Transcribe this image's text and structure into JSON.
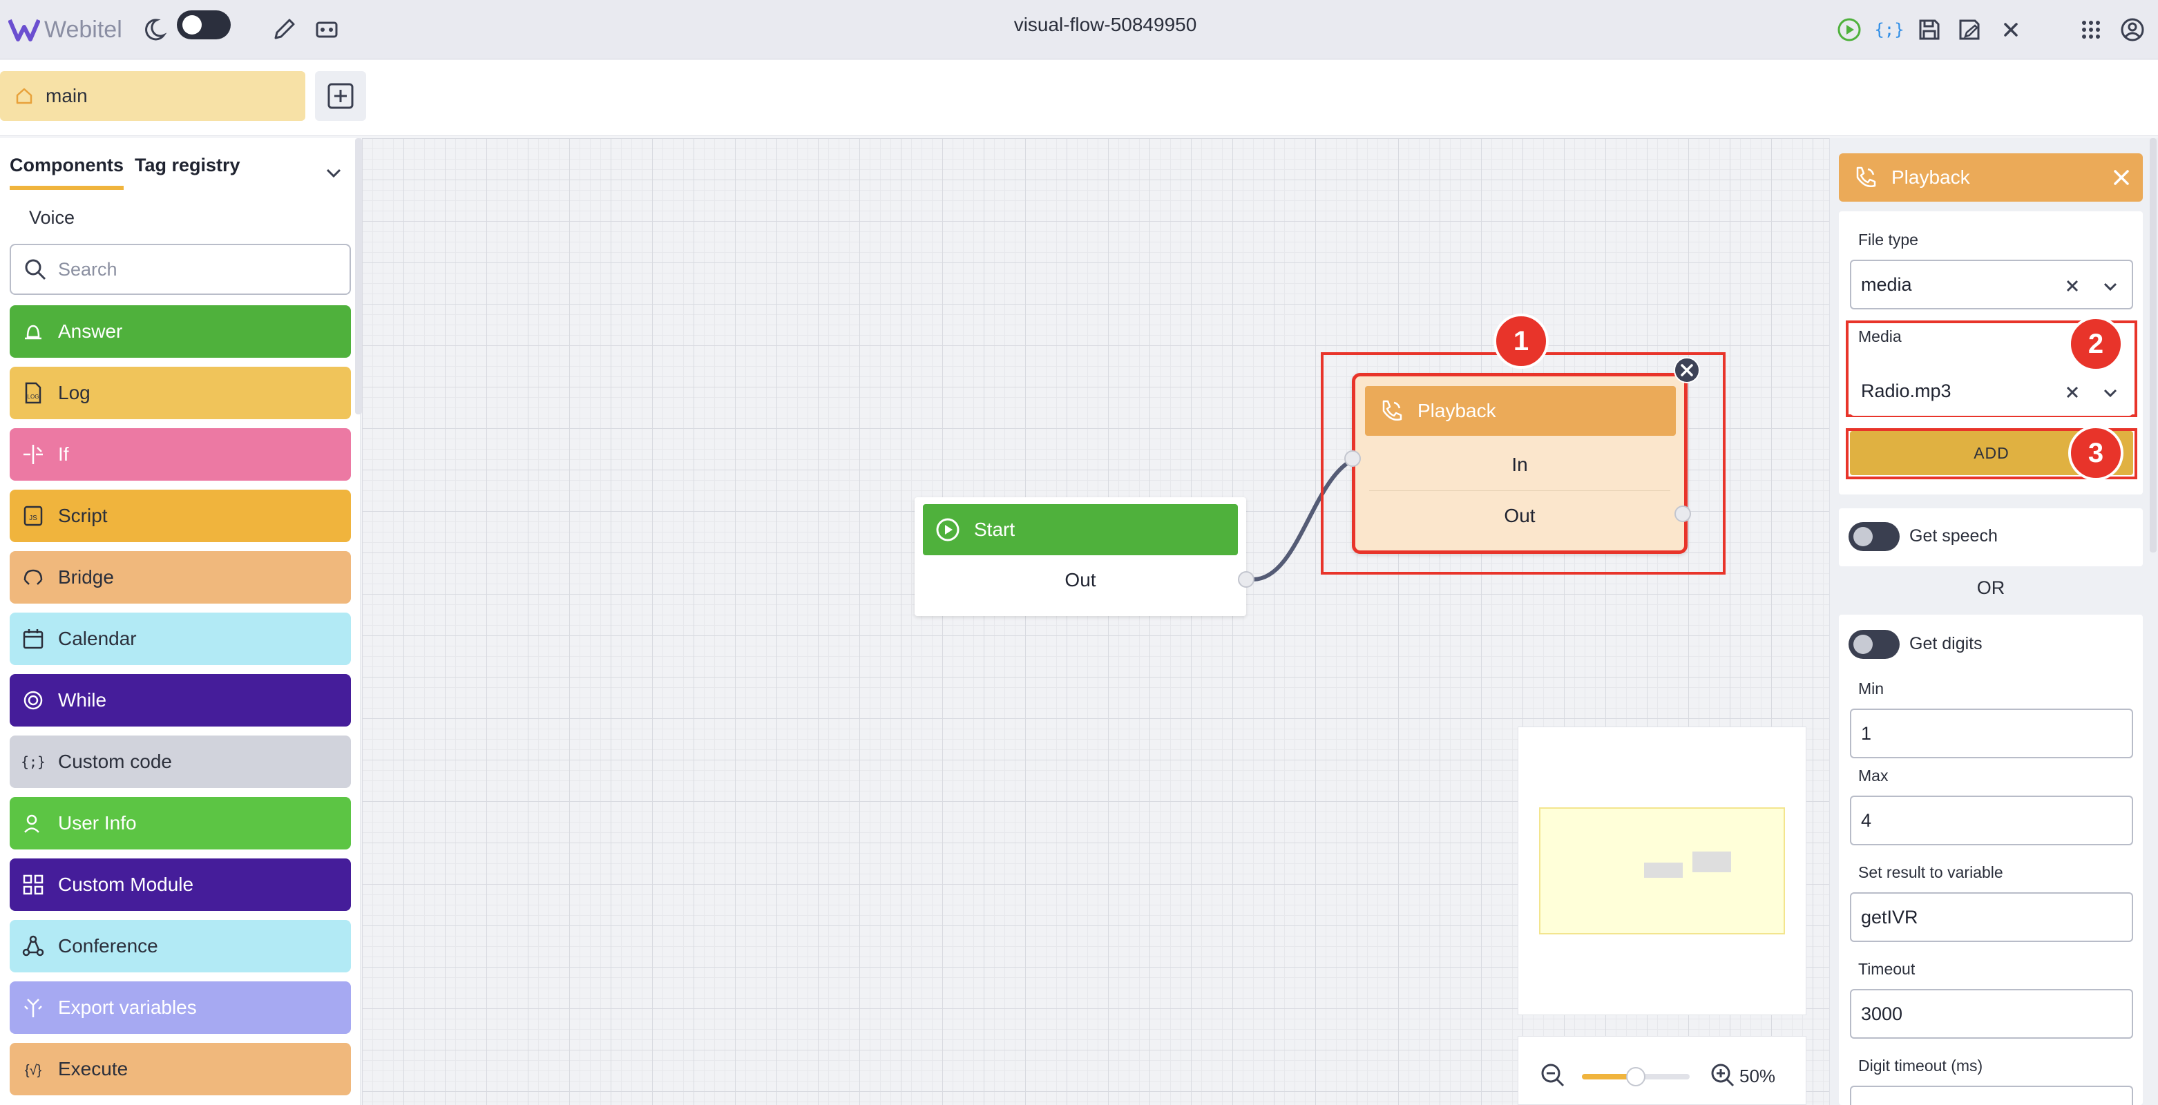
{
  "app": {
    "logo_text": "Webitel",
    "flow_title": "visual-flow-50849950",
    "colors": {
      "accent": "#f0b43d",
      "highlight": "#e8342a",
      "start_green": "#4fb13c",
      "playback_orange": "#ebaa58"
    }
  },
  "tabs": {
    "main_label": "main"
  },
  "sidebar": {
    "tab_components": "Components",
    "tab_tag_registry": "Tag registry",
    "section": "Voice",
    "search_placeholder": "Search",
    "items": [
      {
        "label": "Answer",
        "icon": "answer-icon",
        "bg": "#4fb13c",
        "fg": "#ffffff"
      },
      {
        "label": "Log",
        "icon": "log-icon",
        "bg": "#f0c45a",
        "fg": "#2b2f3b"
      },
      {
        "label": "If",
        "icon": "if-icon",
        "bg": "#ec79a3",
        "fg": "#ffffff"
      },
      {
        "label": "Script",
        "icon": "script-icon",
        "bg": "#f0b43d",
        "fg": "#2b2f3b"
      },
      {
        "label": "Bridge",
        "icon": "bridge-icon",
        "bg": "#f0b87c",
        "fg": "#2b2f3b"
      },
      {
        "label": "Calendar",
        "icon": "calendar-icon",
        "bg": "#b2eaf5",
        "fg": "#2b2f3b"
      },
      {
        "label": "While",
        "icon": "while-icon",
        "bg": "#451d9a",
        "fg": "#ffffff"
      },
      {
        "label": "Custom code",
        "icon": "custom-code-icon",
        "bg": "#d1d3dc",
        "fg": "#2b2f3b"
      },
      {
        "label": "User Info",
        "icon": "user-info-icon",
        "bg": "#5cc544",
        "fg": "#ffffff"
      },
      {
        "label": "Custom Module",
        "icon": "custom-module-icon",
        "bg": "#451d9a",
        "fg": "#ffffff"
      },
      {
        "label": "Conference",
        "icon": "conference-icon",
        "bg": "#b2eaf5",
        "fg": "#2b2f3b"
      },
      {
        "label": "Export variables",
        "icon": "export-variables-icon",
        "bg": "#a6a9f2",
        "fg": "#ffffff"
      },
      {
        "label": "Execute",
        "icon": "execute-icon",
        "bg": "#f0b87c",
        "fg": "#2b2f3b"
      }
    ]
  },
  "canvas": {
    "start_node": {
      "title": "Start",
      "out_label": "Out"
    },
    "playback_node": {
      "title": "Playback",
      "in_label": "In",
      "out_label": "Out"
    },
    "badges": [
      "1",
      "2",
      "3"
    ],
    "zoom": {
      "label": "50%",
      "level": 0.5
    }
  },
  "panel": {
    "title": "Playback",
    "file_type_label": "File type",
    "file_type_value": "media",
    "media_label": "Media",
    "media_value": "Radio.mp3",
    "add_label": "ADD",
    "get_speech_label": "Get speech",
    "or_label": "OR",
    "get_digits_label": "Get digits",
    "min_label": "Min",
    "min_value": "1",
    "max_label": "Max",
    "max_value": "4",
    "result_label": "Set result to variable",
    "result_value": "getIVR",
    "timeout_label": "Timeout",
    "timeout_value": "3000",
    "digit_timeout_label": "Digit timeout (ms)"
  }
}
